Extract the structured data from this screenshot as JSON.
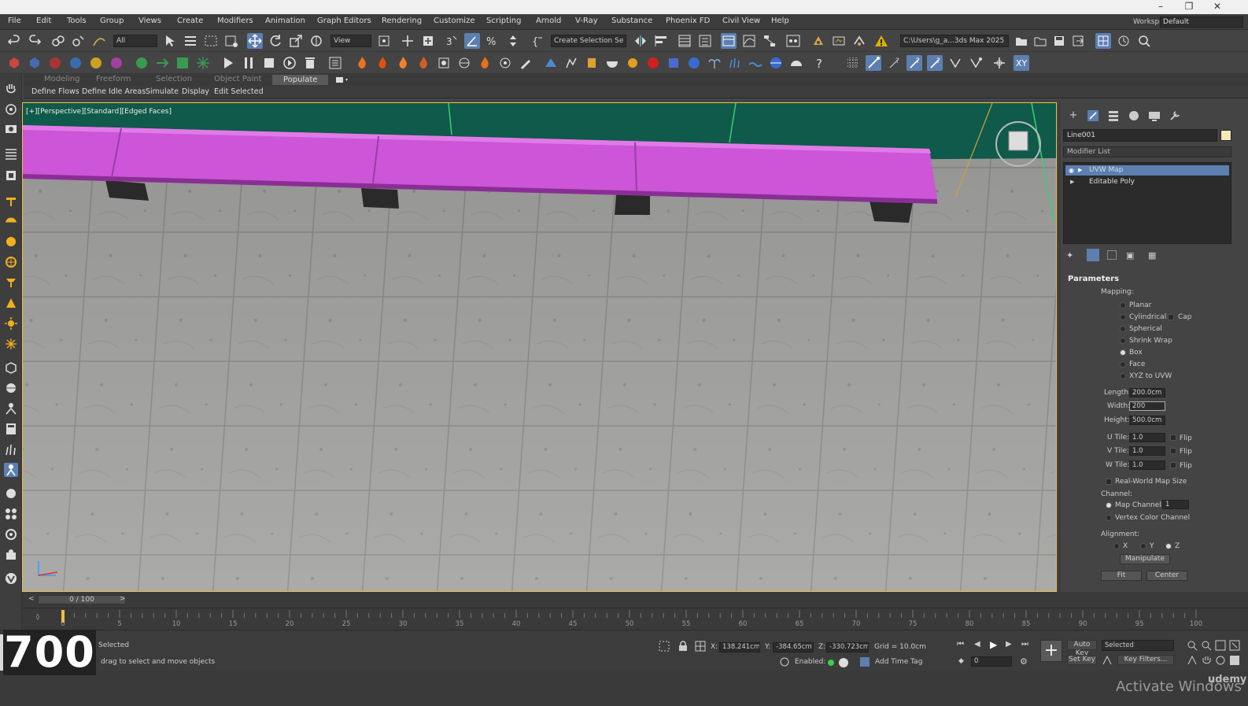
{
  "menu": {
    "items": [
      "File",
      "Edit",
      "Tools",
      "Group",
      "Views",
      "Create",
      "Modifiers",
      "Animation",
      "Graph Editors",
      "Rendering",
      "Customize",
      "Scripting",
      "Arnold",
      "V-Ray",
      "Substance",
      "Phoenix FD",
      "Civil View",
      "Help"
    ],
    "workspaces_label": "Workspaces:",
    "workspaces_value": "Default"
  },
  "toolbar": {
    "filter_value": "All",
    "ref_coord_value": "View",
    "selection_set_placeholder": "Create Selection Se",
    "project_path": "C:\\Users\\g_a...3ds Max 2025"
  },
  "ribbon": {
    "tabs": [
      "Modeling",
      "Freeform",
      "Selection",
      "Object Paint",
      "Populate"
    ],
    "active_tab": "Populate",
    "sub_items": [
      "Define Flows",
      "Define Idle Areas",
      "Simulate",
      "Display",
      "Edit Selected"
    ]
  },
  "viewport": {
    "label": "[+][Perspective][Standard][Edged Faces]"
  },
  "command_panel": {
    "object_name": "Line001",
    "modifier_list_label": "Modifier List",
    "stack": [
      "UVW Map",
      "Editable Poly"
    ],
    "selected_stack_item": "UVW Map",
    "params_title": "Parameters",
    "mapping_label": "Mapping:",
    "mapping_options": [
      "Planar",
      "Cylindrical",
      "Spherical",
      "Shrink Wrap",
      "Box",
      "Face",
      "XYZ to UVW"
    ],
    "mapping_selected": "Box",
    "cap_label": "Cap",
    "length_label": "Length:",
    "length_value": "200.0cm",
    "width_label": "Width:",
    "width_value": "200",
    "height_label": "Height:",
    "height_value": "500.0cm",
    "utile_label": "U Tile:",
    "utile_value": "1.0",
    "vtile_label": "V Tile:",
    "vtile_value": "1.0",
    "wtile_label": "W Tile:",
    "wtile_value": "1.0",
    "flip_label": "Flip",
    "realworld_label": "Real-World Map Size",
    "channel_label": "Channel:",
    "map_channel_label": "Map Channel:",
    "map_channel_value": "1",
    "vertex_color_label": "Vertex Color Channel",
    "alignment_label": "Alignment:",
    "align_x": "X",
    "align_y": "Y",
    "align_z": "Z",
    "manipulate_label": "Manipulate",
    "fit_label": "Fit",
    "center_label": "Center"
  },
  "timeline": {
    "frame_display": "0 / 100",
    "prev": "<",
    "next": ">",
    "ticks": [
      "0",
      "5",
      "10",
      "15",
      "20",
      "25",
      "30",
      "35",
      "40",
      "45",
      "50",
      "55",
      "60",
      "65",
      "70",
      "75",
      "80",
      "85",
      "90",
      "95",
      "100"
    ]
  },
  "status": {
    "selected_text": "Selected",
    "prompt_text": "drag to select and move objects",
    "x_label": "X:",
    "x_value": "138.241cm",
    "y_label": "Y:",
    "y_value": "-384.65cm",
    "z_label": "Z:",
    "z_value": "-330.723cm",
    "grid_text": "Grid = 10.0cm",
    "enabled_label": "Enabled:",
    "add_time_tag": "Add Time Tag",
    "auto_key": "Auto Key",
    "set_key": "Set Key",
    "selected_dropdown": "Selected",
    "key_filters": "Key Filters...",
    "frame_input": "0"
  },
  "overlay": {
    "big_number": "700",
    "watermark": "Activate Windows",
    "udemy": "udemy"
  },
  "colors": {
    "accent": "#5c7fb0",
    "viewport_border": "#f0c040",
    "bench": "#cc55d8",
    "sky": "#0f5a4a"
  }
}
